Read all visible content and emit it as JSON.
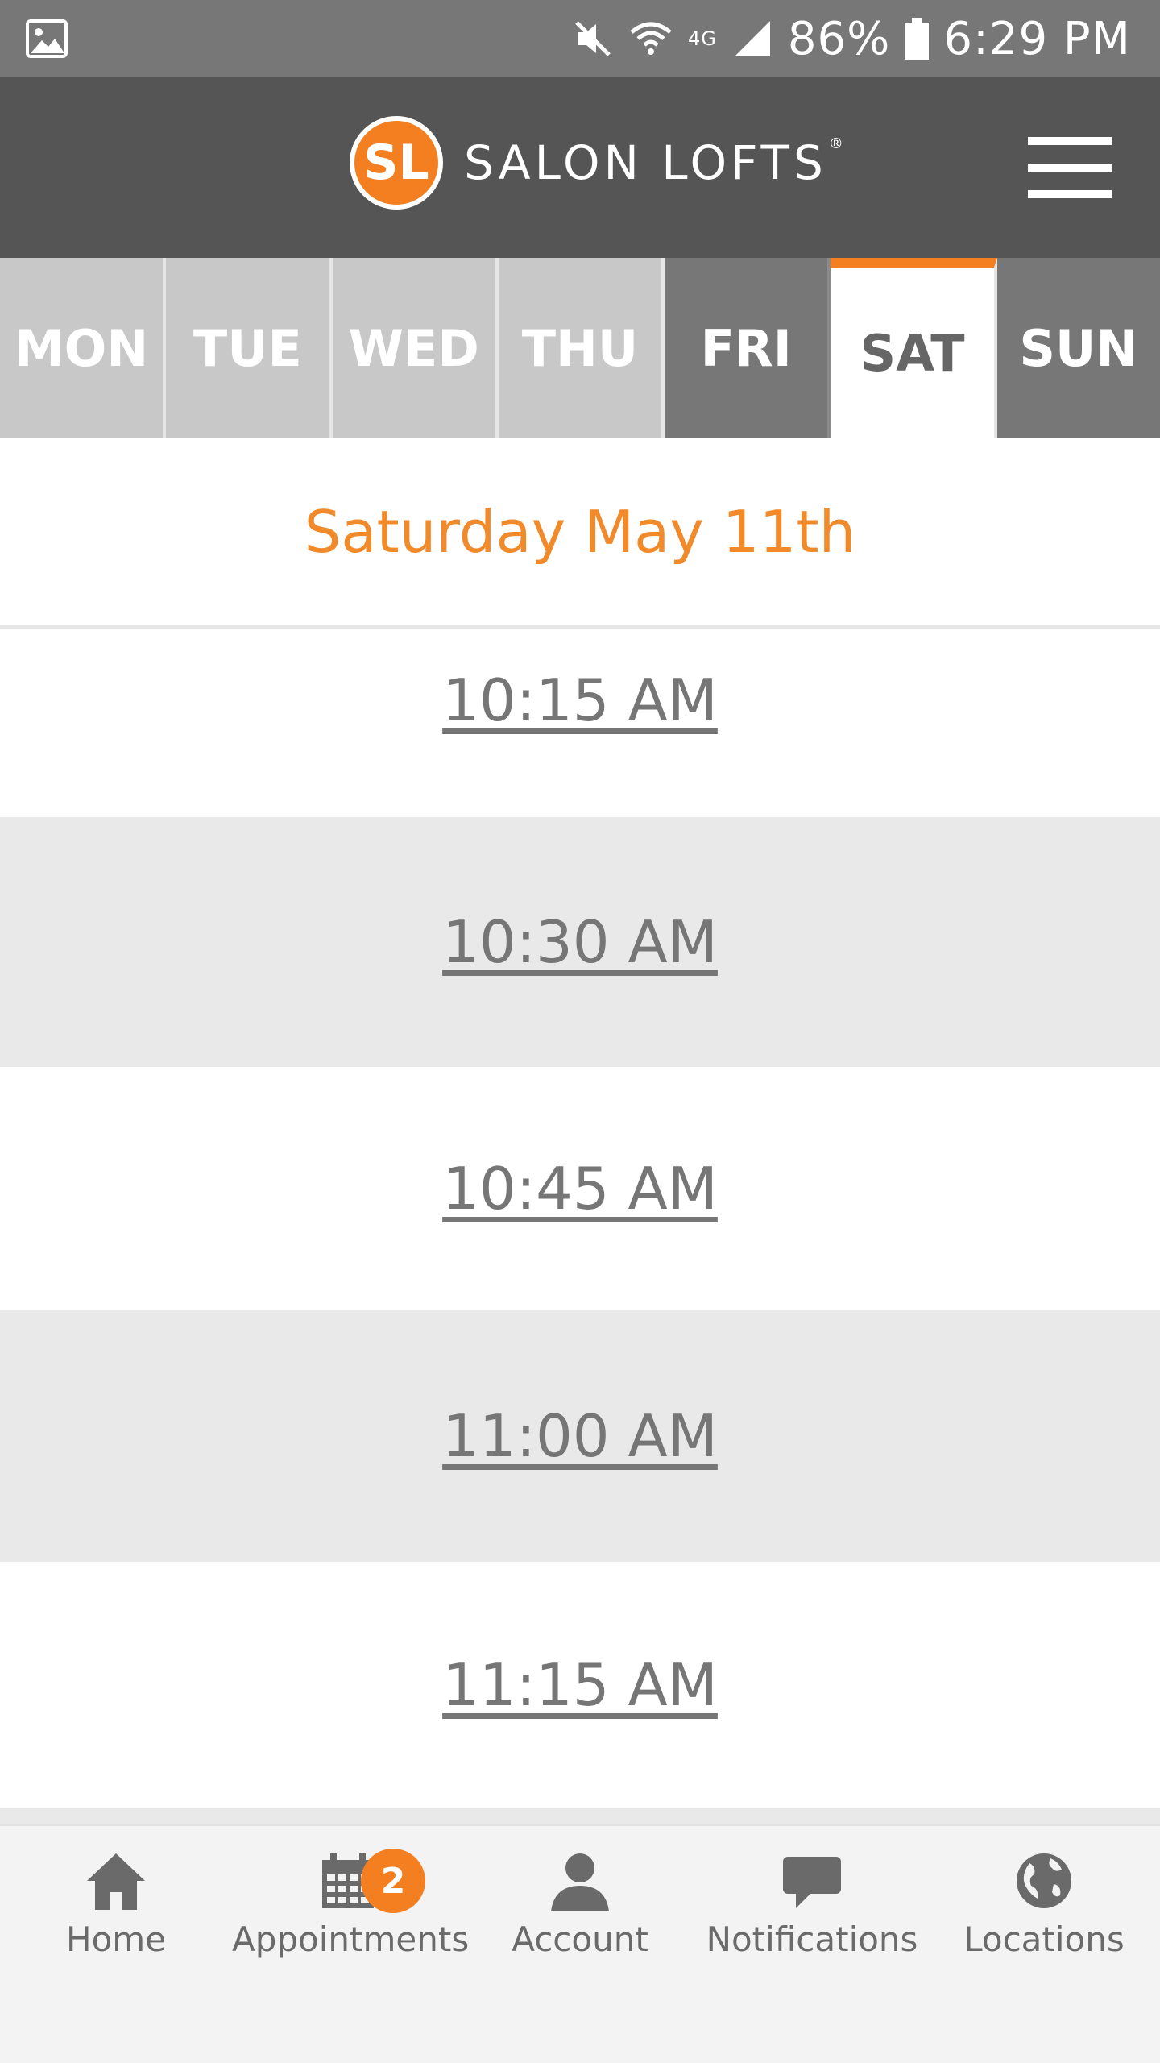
{
  "status_bar": {
    "battery": "86%",
    "time": "6:29 PM",
    "network": "4G"
  },
  "header": {
    "logo_initials": "SL",
    "brand_name": "SALON LOFTS",
    "registered_mark": "®"
  },
  "days": [
    {
      "label": "MON",
      "state": "unavailable"
    },
    {
      "label": "TUE",
      "state": "unavailable"
    },
    {
      "label": "WED",
      "state": "unavailable"
    },
    {
      "label": "THU",
      "state": "unavailable"
    },
    {
      "label": "FRI",
      "state": "available"
    },
    {
      "label": "SAT",
      "state": "selected"
    },
    {
      "label": "SUN",
      "state": "available"
    }
  ],
  "selected_date": "Saturday May 11th",
  "time_slots": [
    "10:15 AM",
    "10:30 AM",
    "10:45 AM",
    "11:00 AM",
    "11:15 AM"
  ],
  "bottom_nav": {
    "home": "Home",
    "appointments": "Appointments",
    "appointments_badge": "2",
    "account": "Account",
    "notifications": "Notifications",
    "locations": "Locations"
  },
  "colors": {
    "accent": "#f47f20",
    "header_bg": "#555555",
    "status_bar_bg": "#777777"
  }
}
